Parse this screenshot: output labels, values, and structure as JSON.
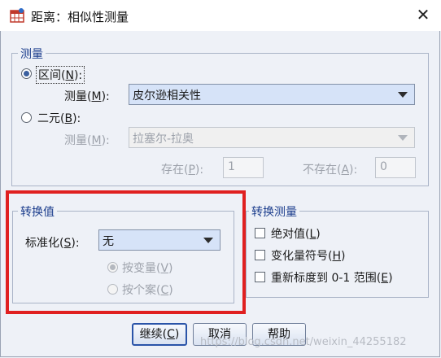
{
  "window": {
    "title": "距离：相似性测量",
    "app_icon": "table-grid-icon",
    "close_glyph": "✕"
  },
  "measure_group": {
    "title": "测量",
    "interval": {
      "label": "区间",
      "key": "N",
      "selected": true,
      "measure_label": "测量",
      "measure_key": "M",
      "measure_value": "皮尔逊相关性"
    },
    "binary": {
      "label": "二元",
      "key": "B",
      "selected": false,
      "measure_label": "测量",
      "measure_key": "M",
      "measure_value": "拉塞尔-拉奥",
      "present_label": "存在",
      "present_key": "P",
      "present_value": "1",
      "absent_label": "不存在",
      "absent_key": "A",
      "absent_value": "0"
    }
  },
  "transform_values": {
    "title": "转换值",
    "standardize_label": "标准化",
    "standardize_key": "S",
    "standardize_value": "无",
    "by_variable": {
      "label": "按变量",
      "key": "V",
      "selected": true
    },
    "by_case": {
      "label": "按个案",
      "key": "C",
      "selected": false
    }
  },
  "transform_measures": {
    "title": "转换测量",
    "absolute": {
      "label": "绝对值",
      "key": "L",
      "checked": false
    },
    "change_sign": {
      "label": "变化量符号",
      "key": "H",
      "checked": false
    },
    "rescale": {
      "label": "重新标度到 0-1 范围",
      "key": "E",
      "checked": false
    }
  },
  "buttons": {
    "continue": {
      "label": "继续",
      "key": "C"
    },
    "cancel": {
      "label": "取消"
    },
    "help": {
      "label": "帮助"
    }
  },
  "watermark": "https://blog.csdn.net/weixin_44255182",
  "colors": {
    "highlight": "#e02020",
    "group_title": "#1a3c8c",
    "select_bg": "#d6e3f8"
  }
}
